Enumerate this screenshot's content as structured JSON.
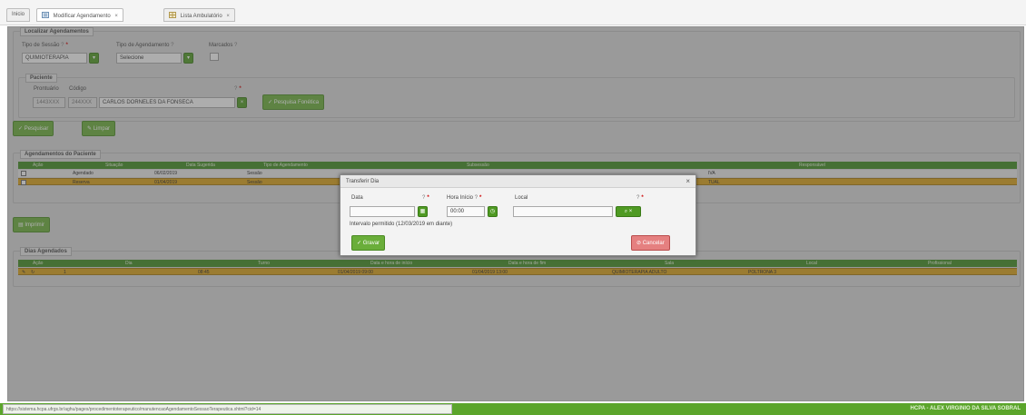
{
  "tabs": [
    {
      "label": "Inicio",
      "icon": "none",
      "closable": false
    },
    {
      "label": "Modificar Agendamento",
      "icon": "document-icon",
      "closable": true
    },
    {
      "label": "Lista Ambulatório",
      "icon": "grid-icon",
      "closable": true
    }
  ],
  "search": {
    "legend": "Localizar Agendamentos",
    "tipo_sessao_label": "Tipo de Sessão",
    "tipo_sessao_value": "QUIMIOTERAPIA",
    "tipo_agendamento_label": "Tipo de Agendamento",
    "tipo_agendamento_value": "Selecione",
    "marcados_label": "Marcados",
    "help_mark": "?"
  },
  "paciente": {
    "legend": "Paciente",
    "prontuario_label": "Prontuário",
    "codigo_label": "Código",
    "prontuario_value": "1443XXX",
    "codigo_value": "244XXX",
    "nome": "CARLOS DORNELES DA FONSECA",
    "pesquisa_fonetica": "Pesquisa Fonética",
    "help_mark": "?"
  },
  "actions": {
    "pesquisar": "Pesquisar",
    "limpar": "Limpar",
    "imprimir": "Imprimir"
  },
  "agendamentos": {
    "legend": "Agendamentos do Paciente",
    "columns": [
      "Ação",
      "Situação",
      "Data Sugerida",
      "Tipo de Agendamento",
      "Subsessão",
      "Responsável"
    ],
    "rows": [
      {
        "situacao": "Agendado",
        "data": "06/02/2019",
        "tipo": "Sessão",
        "tail": "IVA"
      },
      {
        "situacao": "Reserva",
        "data": "01/04/2019",
        "tipo": "Sessão",
        "tail": "TUAL"
      }
    ]
  },
  "dias": {
    "legend": "Dias Agendados",
    "columns": [
      "Ação",
      "Dia",
      "Turno",
      "Data e hora de início",
      "Data e hora de fim",
      "Sala",
      "Local",
      "Profissional"
    ],
    "rows": [
      {
        "dia": "1",
        "turno": "08:45",
        "inicio": "01/04/2019 09:00",
        "fim": "01/04/2019 13:00",
        "sala": "QUIMIOTERAPIA ADULTO",
        "local": "POLTRONA 3",
        "profissional": ""
      }
    ]
  },
  "modal": {
    "title": "Transferir Dia",
    "data_label": "Data",
    "hora_label": "Hora Início",
    "hora_value": "00:00",
    "local_label": "Local",
    "intervalo": "Intervalo permitido (12/03/2019 em diante)",
    "gravar": "Gravar",
    "cancelar": "Cancelar",
    "help_mark": "?"
  },
  "status": {
    "url": "https://sistema.hcpa.ufrgs.br/aghu/pages/procedimentoterapeutico/manutencaoAgendamentoSessaoTerapeutica.xhtml?cid=14",
    "user": "HCPA - ALEX VIRGINIO DA SILVA SOBRAL"
  },
  "colors": {
    "accent": "#4f9a23",
    "header": "#3f8a1f",
    "selected_row": "#d9a019",
    "cancel": "#e58080"
  }
}
